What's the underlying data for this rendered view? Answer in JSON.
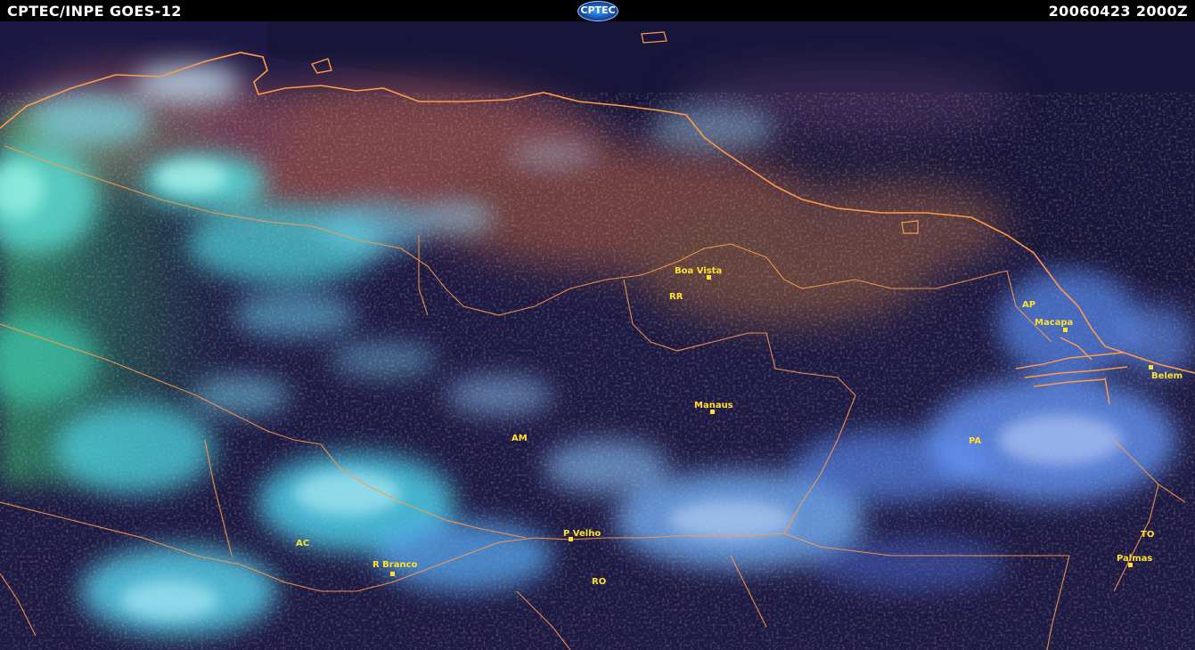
{
  "header": {
    "left_text": "CPTEC/INPE GOES-12",
    "logo_text": "CPTEC",
    "right_text": "20060423 2000Z"
  },
  "colors": {
    "label": "#ffe030",
    "borders": "#ff9a4a",
    "background": "#1c1a44",
    "cloud_cyan": "#4fe3e0",
    "cloud_blue": "#5a8cf0"
  },
  "places": {
    "boa_vista": "Boa Vista",
    "rr": "RR",
    "ap": "AP",
    "macapa": "Macapa",
    "belem": "Belem",
    "manaus": "Manaus",
    "am": "AM",
    "pa": "PA",
    "p_velho": "P Velho",
    "ac": "AC",
    "r_branco": "R Branco",
    "ro": "RO",
    "to": "TO",
    "palmas": "Palmas"
  }
}
